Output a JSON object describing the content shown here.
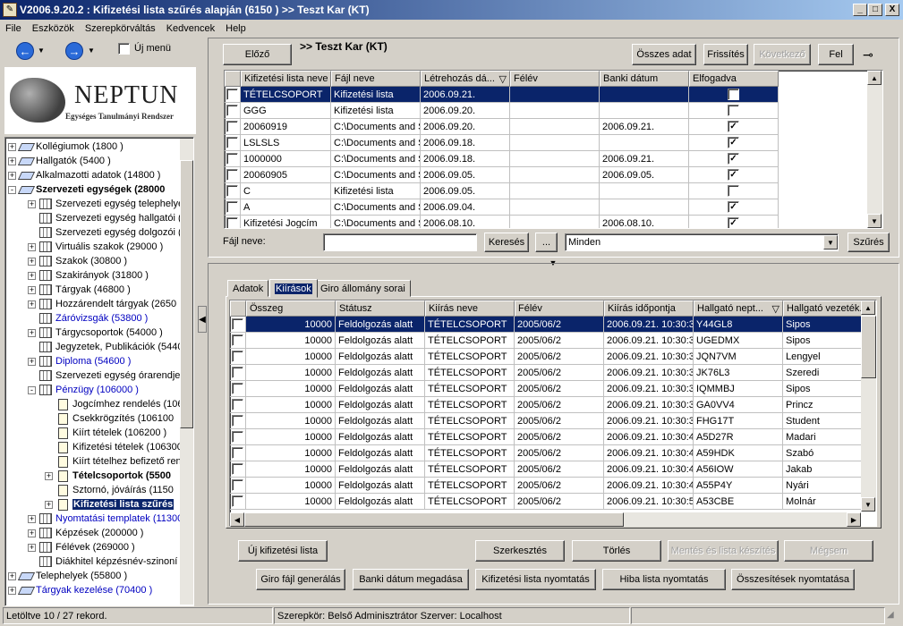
{
  "window": {
    "title": "V2006.9.20.2 : Kifizetési lista szűrés alapján (6150  )  >> Teszt Kar (KT)",
    "buttons": {
      "minimize": "_",
      "maximize": "□",
      "close": "X"
    }
  },
  "menu": [
    "File",
    "Eszközök",
    "Szerepkörváltás",
    "Kedvencek",
    "Help"
  ],
  "toolbar": {
    "new_menu_label": "Új menü"
  },
  "logo": {
    "name": "NEPTUN",
    "subtitle": "Egységes Tanulmányi Rendszer"
  },
  "tree": [
    {
      "label": "Kollégiumok (1800  )",
      "indent": 0,
      "exp": "+",
      "icon": "book-icon",
      "style": ""
    },
    {
      "label": "Hallgatók (5400  )",
      "indent": 0,
      "exp": "+",
      "icon": "book-icon",
      "style": ""
    },
    {
      "label": "Alkalmazotti adatok (14800  )",
      "indent": 0,
      "exp": "+",
      "icon": "book-icon",
      "style": ""
    },
    {
      "label": "Szervezeti egységek (28000",
      "indent": 0,
      "exp": "-",
      "icon": "book-icon",
      "style": "bold"
    },
    {
      "label": "Szervezeti egység telephelye",
      "indent": 1,
      "exp": "+",
      "icon": "grid-icon",
      "style": ""
    },
    {
      "label": "Szervezeti egység hallgatói (2",
      "indent": 1,
      "exp": "",
      "icon": "grid-icon",
      "style": ""
    },
    {
      "label": "Szervezeti egység dolgozói (2",
      "indent": 1,
      "exp": "",
      "icon": "grid-icon",
      "style": ""
    },
    {
      "label": "Virtuális szakok (29000  )",
      "indent": 1,
      "exp": "+",
      "icon": "grid-icon",
      "style": ""
    },
    {
      "label": "Szakok (30800  )",
      "indent": 1,
      "exp": "+",
      "icon": "grid-icon",
      "style": ""
    },
    {
      "label": "Szakirányok (31800  )",
      "indent": 1,
      "exp": "+",
      "icon": "grid-icon",
      "style": ""
    },
    {
      "label": "Tárgyak (46800  )",
      "indent": 1,
      "exp": "+",
      "icon": "grid-icon",
      "style": ""
    },
    {
      "label": "Hozzárendelt tárgyak (2650",
      "indent": 1,
      "exp": "+",
      "icon": "grid-icon",
      "style": ""
    },
    {
      "label": "Záróvizsgák (53800  )",
      "indent": 1,
      "exp": "",
      "icon": "grid-icon",
      "style": "blue"
    },
    {
      "label": "Tárgycsoportok (54000  )",
      "indent": 1,
      "exp": "+",
      "icon": "grid-icon",
      "style": ""
    },
    {
      "label": "Jegyzetek, Publikációk (5440",
      "indent": 1,
      "exp": "",
      "icon": "grid-icon",
      "style": ""
    },
    {
      "label": "Diploma (54600  )",
      "indent": 1,
      "exp": "+",
      "icon": "grid-icon",
      "style": "blue"
    },
    {
      "label": "Szervezeti egység órarendje",
      "indent": 1,
      "exp": "",
      "icon": "grid-icon",
      "style": ""
    },
    {
      "label": "Pénzügy (106000  )",
      "indent": 1,
      "exp": "-",
      "icon": "grid-icon",
      "style": "blue"
    },
    {
      "label": "Jogcímhez rendelés (106",
      "indent": 2,
      "exp": "",
      "icon": "doc-icon",
      "style": ""
    },
    {
      "label": "Csekkrögzítés (106100",
      "indent": 2,
      "exp": "",
      "icon": "doc-icon",
      "style": ""
    },
    {
      "label": "Kiírt tételek (106200  )",
      "indent": 2,
      "exp": "",
      "icon": "doc-icon",
      "style": ""
    },
    {
      "label": "Kifizetési tételek (106300",
      "indent": 2,
      "exp": "",
      "icon": "doc-icon",
      "style": ""
    },
    {
      "label": "Kiírt tételhez befizető ren",
      "indent": 2,
      "exp": "",
      "icon": "doc-icon",
      "style": ""
    },
    {
      "label": "Tételcsoportok (5500",
      "indent": 2,
      "exp": "+",
      "icon": "doc-icon",
      "style": "bold"
    },
    {
      "label": "Sztornó, jóváírás (1150",
      "indent": 2,
      "exp": "",
      "icon": "doc-icon",
      "style": ""
    },
    {
      "label": "Kifizetési lista szűrés",
      "indent": 2,
      "exp": "+",
      "icon": "doc-icon",
      "style": "selected"
    },
    {
      "label": "Nyomtatási templatek (11300",
      "indent": 1,
      "exp": "+",
      "icon": "grid-icon",
      "style": "blue"
    },
    {
      "label": "Képzések (200000  )",
      "indent": 1,
      "exp": "+",
      "icon": "grid-icon",
      "style": ""
    },
    {
      "label": "Félévek (269000  )",
      "indent": 1,
      "exp": "+",
      "icon": "grid-icon",
      "style": ""
    },
    {
      "label": "Diákhitel képzésnév-szinoní",
      "indent": 1,
      "exp": "",
      "icon": "grid-icon",
      "style": ""
    },
    {
      "label": "Telephelyek (55800  )",
      "indent": 0,
      "exp": "+",
      "icon": "book-icon",
      "style": ""
    },
    {
      "label": "Tárgyak kezelése (70400  )",
      "indent": 0,
      "exp": "+",
      "icon": "book-icon",
      "style": "blue"
    }
  ],
  "top": {
    "prev_button": "Előző",
    "context": ">> Teszt Kar (KT)",
    "all_data_button": "Összes adat",
    "refresh_button": "Frissítés",
    "next_button": "Következő",
    "up_button": "Fel",
    "file_name_label": "Fájl neve:",
    "file_name_value": "",
    "search_button": "Keresés",
    "ellipsis_button": "...",
    "filter_select": "Minden",
    "filter_button": "Szűrés"
  },
  "top_table": {
    "headers": [
      "Kifizetési lista neve",
      "Fájl neve",
      "Létrehozás dá...",
      "Félév",
      "Banki dátum",
      "Elfogadva"
    ],
    "rows": [
      {
        "name": "TÉTELCSOPORT",
        "file": "Kifizetési lista",
        "created": "2006.09.21.",
        "term": "",
        "bank": "",
        "accepted": false,
        "selected": true
      },
      {
        "name": "GGG",
        "file": "Kifizetési lista",
        "created": "2006.09.20.",
        "term": "",
        "bank": "",
        "accepted": false
      },
      {
        "name": "20060919",
        "file": "C:\\Documents and S",
        "created": "2006.09.20.",
        "term": "",
        "bank": "2006.09.21.",
        "accepted": true
      },
      {
        "name": "LSLSLS",
        "file": "C:\\Documents and S",
        "created": "2006.09.18.",
        "term": "",
        "bank": "",
        "accepted": true
      },
      {
        "name": "1000000",
        "file": "C:\\Documents and S",
        "created": "2006.09.18.",
        "term": "",
        "bank": "2006.09.21.",
        "accepted": true
      },
      {
        "name": "20060905",
        "file": "C:\\Documents and S",
        "created": "2006.09.05.",
        "term": "",
        "bank": "2006.09.05.",
        "accepted": true
      },
      {
        "name": "C",
        "file": "Kifizetési lista",
        "created": "2006.09.05.",
        "term": "",
        "bank": "",
        "accepted": false
      },
      {
        "name": "A",
        "file": "C:\\Documents and S",
        "created": "2006.09.04.",
        "term": "",
        "bank": "",
        "accepted": true
      },
      {
        "name": "Kifizetési Jogcím",
        "file": "C:\\Documents and S",
        "created": "2006.08.10.",
        "term": "",
        "bank": "2006.08.10.",
        "accepted": true
      }
    ]
  },
  "tabs": [
    "Adatok",
    "Kiírások",
    "Giro állomány sorai"
  ],
  "bottom_table": {
    "headers": [
      "Összeg",
      "Státusz",
      "Kiírás neve",
      "Félév",
      "Kiírás időpontja",
      "Hallgató nept...",
      "Hallgató vezeték..."
    ],
    "rows": [
      {
        "amount": "10000",
        "status": "Feldolgozás alatt",
        "name": "TÉTELCSOPORT",
        "term": "2005/06/2",
        "time": "2006.09.21. 10:30:3",
        "neptun": "Y44GL8",
        "surname": "Sipos",
        "selected": true
      },
      {
        "amount": "10000",
        "status": "Feldolgozás alatt",
        "name": "TÉTELCSOPORT",
        "term": "2005/06/2",
        "time": "2006.09.21. 10:30:3",
        "neptun": "UGEDMX",
        "surname": "Sipos"
      },
      {
        "amount": "10000",
        "status": "Feldolgozás alatt",
        "name": "TÉTELCSOPORT",
        "term": "2005/06/2",
        "time": "2006.09.21. 10:30:3",
        "neptun": "JQN7VM",
        "surname": "Lengyel"
      },
      {
        "amount": "10000",
        "status": "Feldolgozás alatt",
        "name": "TÉTELCSOPORT",
        "term": "2005/06/2",
        "time": "2006.09.21. 10:30:3",
        "neptun": "JK76L3",
        "surname": "Szeredi"
      },
      {
        "amount": "10000",
        "status": "Feldolgozás alatt",
        "name": "TÉTELCSOPORT",
        "term": "2005/06/2",
        "time": "2006.09.21. 10:30:3",
        "neptun": "IQMMBJ",
        "surname": "Sipos"
      },
      {
        "amount": "10000",
        "status": "Feldolgozás alatt",
        "name": "TÉTELCSOPORT",
        "term": "2005/06/2",
        "time": "2006.09.21. 10:30:3",
        "neptun": "GA0VV4",
        "surname": "Princz"
      },
      {
        "amount": "10000",
        "status": "Feldolgozás alatt",
        "name": "TÉTELCSOPORT",
        "term": "2005/06/2",
        "time": "2006.09.21. 10:30:3",
        "neptun": "FHG17T",
        "surname": "Student"
      },
      {
        "amount": "10000",
        "status": "Feldolgozás alatt",
        "name": "TÉTELCSOPORT",
        "term": "2005/06/2",
        "time": "2006.09.21. 10:30:4",
        "neptun": "A5D27R",
        "surname": "Madari"
      },
      {
        "amount": "10000",
        "status": "Feldolgozás alatt",
        "name": "TÉTELCSOPORT",
        "term": "2005/06/2",
        "time": "2006.09.21. 10:30:4",
        "neptun": "A59HDK",
        "surname": "Szabó"
      },
      {
        "amount": "10000",
        "status": "Feldolgozás alatt",
        "name": "TÉTELCSOPORT",
        "term": "2005/06/2",
        "time": "2006.09.21. 10:30:4",
        "neptun": "A56IOW",
        "surname": "Jakab"
      },
      {
        "amount": "10000",
        "status": "Feldolgozás alatt",
        "name": "TÉTELCSOPORT",
        "term": "2005/06/2",
        "time": "2006.09.21. 10:30:4",
        "neptun": "A55P4Y",
        "surname": "Nyári"
      },
      {
        "amount": "10000",
        "status": "Feldolgozás alatt",
        "name": "TÉTELCSOPORT",
        "term": "2005/06/2",
        "time": "2006.09.21. 10:30:5",
        "neptun": "A53CBE",
        "surname": "Molnár"
      }
    ]
  },
  "actions_row1": {
    "new_list": "Új kifizetési lista",
    "edit": "Szerkesztés",
    "delete": "Törlés",
    "save_create": "Mentés és lista készítés",
    "cancel": "Mégsem"
  },
  "actions_row2": {
    "giro": "Giro fájl generálás",
    "bank_date": "Banki dátum megadása",
    "print_list": "Kifizetési lista nyomtatás",
    "print_errors": "Hiba lista nyomtatás",
    "print_summary": "Összesítések nyomtatása"
  },
  "status": {
    "loaded": "Letöltve 10 / 27 rekord.",
    "role": "Szerepkör: Belső Adminisztrátor  Szerver: Localhost"
  }
}
